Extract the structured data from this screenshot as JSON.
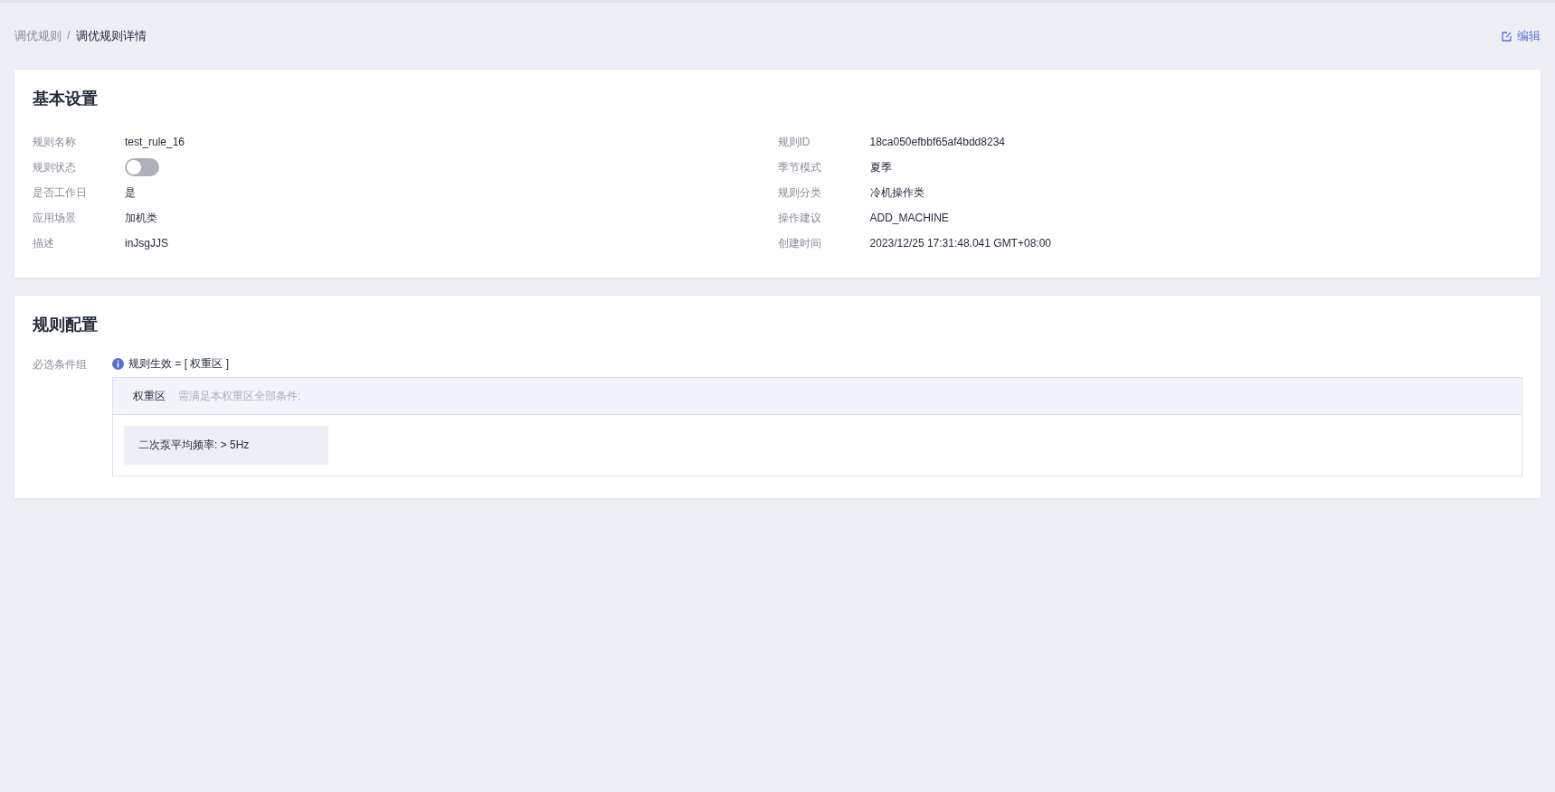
{
  "breadcrumb": [
    {
      "label": "调优规则",
      "current": false
    },
    {
      "label": "调优规则详情",
      "current": true
    }
  ],
  "breadcrumb_separator": "/",
  "edit_button": {
    "label": "编辑"
  },
  "basic_settings": {
    "title": "基本设置",
    "left_fields": [
      {
        "label": "规则名称",
        "kind": "text",
        "value": "test_rule_16"
      },
      {
        "label": "规则状态",
        "kind": "switch",
        "on": false
      },
      {
        "label": "是否工作日",
        "kind": "text",
        "value": "是"
      },
      {
        "label": "应用场景",
        "kind": "text",
        "value": "加机类"
      },
      {
        "label": "描述",
        "kind": "text",
        "value": "inJsgJJS"
      }
    ],
    "right_fields": [
      {
        "label": "规则ID",
        "kind": "text",
        "value": "18ca050efbbf65af4bdd8234"
      },
      {
        "label": "季节模式",
        "kind": "text",
        "value": "夏季"
      },
      {
        "label": "规则分类",
        "kind": "text",
        "value": "冷机操作类"
      },
      {
        "label": "操作建议",
        "kind": "text",
        "value": "ADD_MACHINE"
      },
      {
        "label": "创建时间",
        "kind": "text",
        "value": "2023/12/25 17:31:48.041 GMT+08:00"
      }
    ]
  },
  "rule_config": {
    "title": "规则配置",
    "group_label": "必选条件组",
    "formula": "规则生效 = [ 权重区 ]",
    "zone": {
      "name": "权重区",
      "hint": "需满足本权重区全部条件:",
      "conditions": [
        "二次泵平均频率: > 5Hz"
      ]
    }
  }
}
